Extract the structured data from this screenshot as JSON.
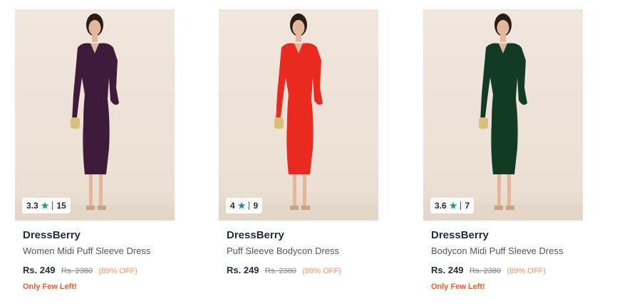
{
  "products": [
    {
      "brand": "DressBerry",
      "name": "Women Midi Puff Sleeve Dress",
      "price": "Rs. 249",
      "mrp": "Rs. 2380",
      "discount": "(89% OFF)",
      "stock_note": "Only Few Left!",
      "rating": "3.3",
      "rating_count": "15",
      "dress_color": "#3e1a3b"
    },
    {
      "brand": "DressBerry",
      "name": "Puff Sleeve Bodycon Dress",
      "price": "Rs. 249",
      "mrp": "Rs. 2380",
      "discount": "(89% OFF)",
      "stock_note": "",
      "rating": "4",
      "rating_count": "9",
      "dress_color": "#ea2a1f"
    },
    {
      "brand": "DressBerry",
      "name": "Bodycon Midi Puff Sleeve Dress",
      "price": "Rs. 249",
      "mrp": "Rs. 2380",
      "discount": "(89% OFF)",
      "stock_note": "Only Few Left!",
      "rating": "3.6",
      "rating_count": "7",
      "dress_color": "#123b23"
    }
  ],
  "icons": {
    "rating": "star-icon"
  },
  "colors": {
    "star": "#14958f",
    "discount": "#ff905a",
    "stock_note": "#ff5722"
  }
}
